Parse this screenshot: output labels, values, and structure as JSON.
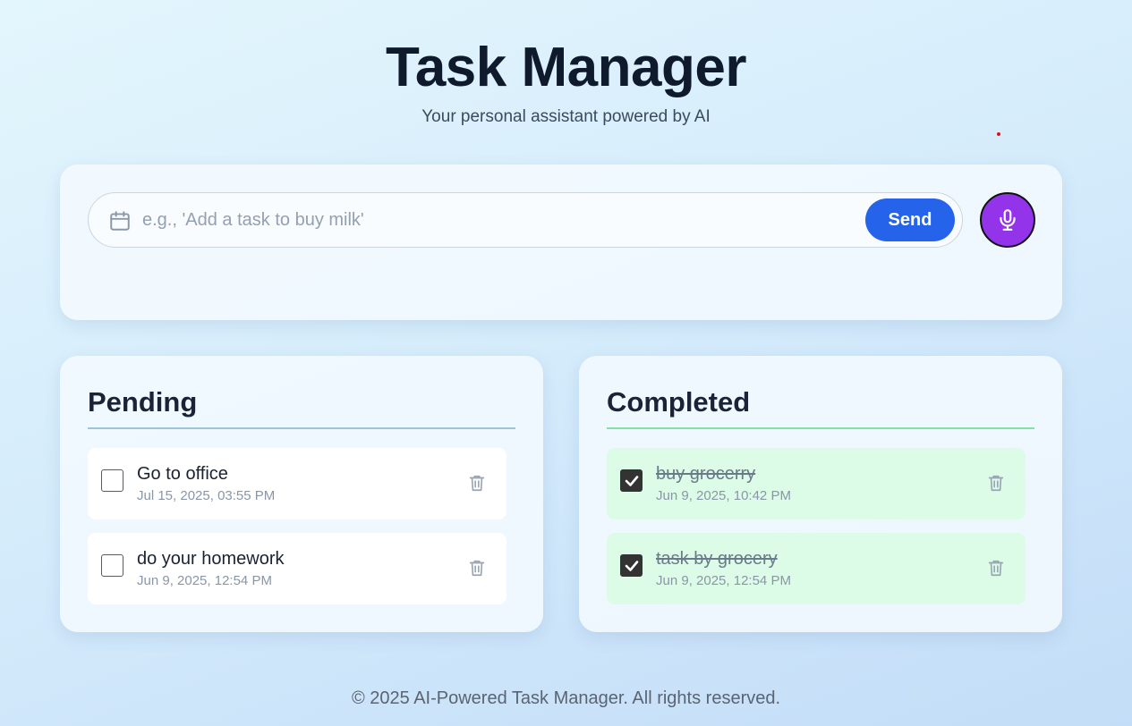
{
  "header": {
    "title": "Task Manager",
    "subtitle": "Your personal assistant powered by AI"
  },
  "input": {
    "placeholder": "e.g., 'Add a task to buy milk'",
    "value": "",
    "send_label": "Send",
    "calendar_icon": "calendar-icon",
    "mic_icon": "microphone-icon"
  },
  "pending": {
    "title": "Pending",
    "tasks": [
      {
        "text": "Go to office",
        "date": "Jul 15, 2025, 03:55 PM",
        "done": false
      },
      {
        "text": "do your homework",
        "date": "Jun 9, 2025, 12:54 PM",
        "done": false
      }
    ]
  },
  "completed": {
    "title": "Completed",
    "tasks": [
      {
        "text": "buy grocerry",
        "date": "Jun 9, 2025, 10:42 PM",
        "done": true
      },
      {
        "text": "task by grocery",
        "date": "Jun 9, 2025, 12:54 PM",
        "done": true
      }
    ]
  },
  "footer": {
    "text": "© 2025 AI-Powered Task Manager. All rights reserved."
  },
  "colors": {
    "send_button": "#2563eb",
    "mic_button": "#9333ea",
    "completed_item_bg": "#dcfce7",
    "pending_rule": "#9cc5d6",
    "completed_rule": "#86e0a6"
  }
}
